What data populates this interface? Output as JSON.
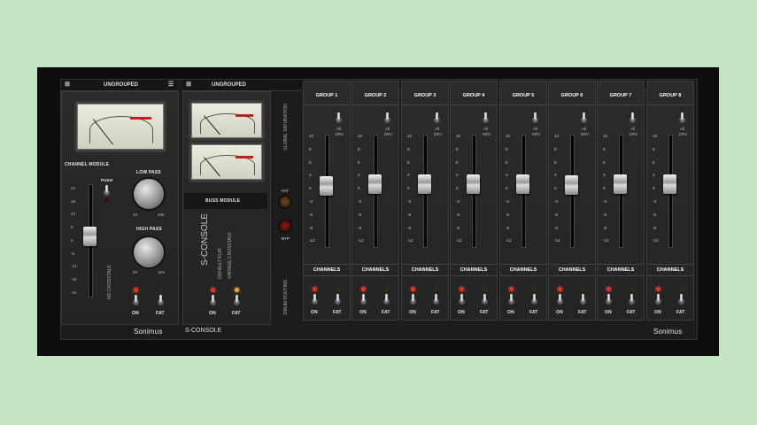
{
  "left_panel": {
    "title": "UNGROUPED",
    "module": "CHANNEL MODULE",
    "push": "PUSH",
    "low_pass": "LOW PASS",
    "lp_min": "1K",
    "lp_max": "40K",
    "high_pass": "HIGH PASS",
    "hp_min": "20",
    "hp_max": "1K5",
    "crosstalk": "NO CROSSTALK",
    "on": "ON",
    "fat": "FAT",
    "scale": [
      "24",
      "18",
      "12",
      "6",
      "0",
      "-6",
      "-12",
      "-18",
      "-24"
    ],
    "brand": "Sonimus"
  },
  "buss_panel": {
    "title": "UNGROUPED",
    "module": "BUSS MODULE",
    "console": "S-CONSOLE",
    "default_flat": "DEFAULT FLAT",
    "vintage_crosstalk": "VINTAGE CROSSTALK",
    "on": "ON",
    "fat": "FAT",
    "footer": "S-CONSOLE"
  },
  "global": {
    "saturation": "GLOBAL SATURATION",
    "fat": "FAT",
    "byp": "BYP",
    "routing": "DRUM ROUTING"
  },
  "groups": [
    {
      "name": "GROUP 1"
    },
    {
      "name": "GROUP 2"
    },
    {
      "name": "GROUP 3"
    },
    {
      "name": "GROUP 4"
    },
    {
      "name": "GROUP 5"
    },
    {
      "name": "GROUP 6"
    },
    {
      "name": "GROUP 7"
    },
    {
      "name": "GROUP 8"
    }
  ],
  "group_common": {
    "all": "All",
    "drv": "DRV",
    "channels": "CHANNELS",
    "on": "ON",
    "fat": "FAT",
    "scale": [
      "12",
      "9",
      "6",
      "3",
      "0",
      "-3",
      "-6",
      "-9",
      "-12"
    ]
  },
  "footer_brand": "Sonimus",
  "colors": {
    "led_red": "#e8321e",
    "led_amber": "#e8a52a",
    "meter_face": "#ececdf"
  }
}
